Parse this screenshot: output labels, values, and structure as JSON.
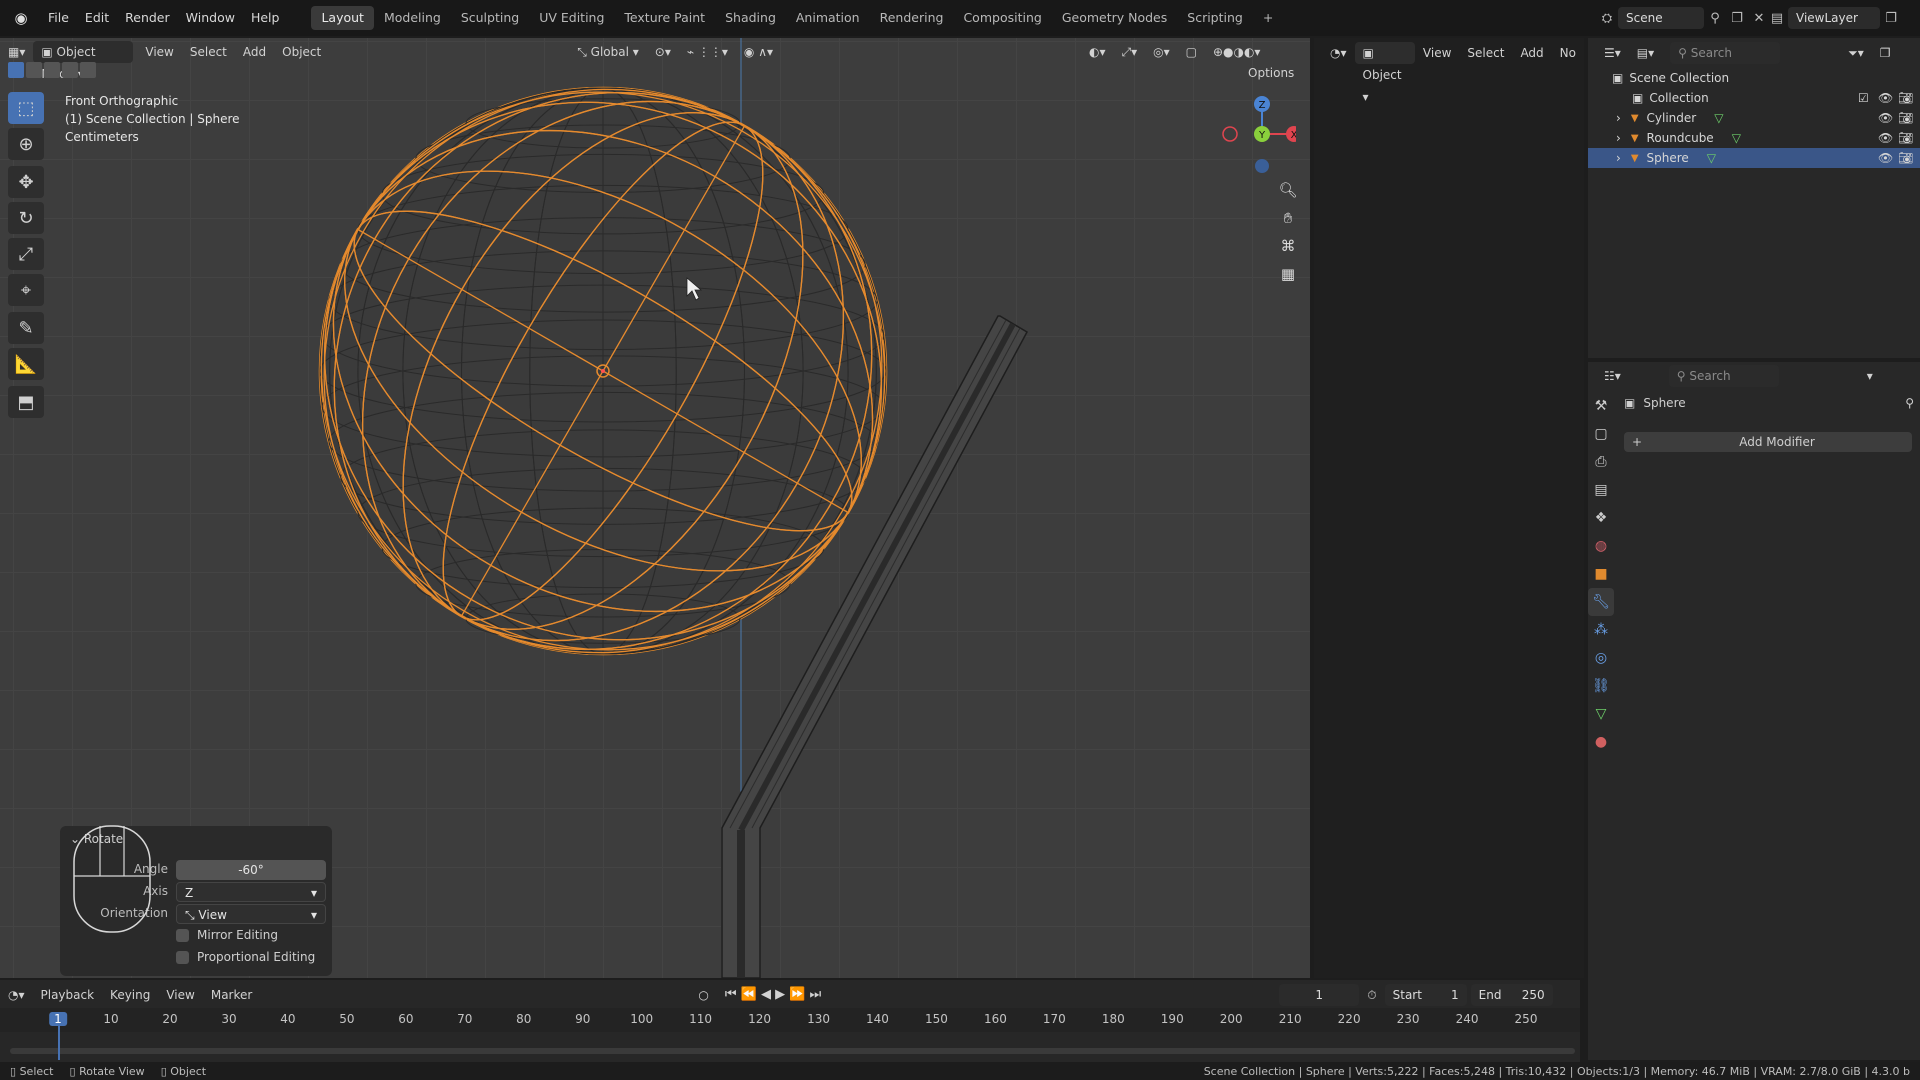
{
  "topbar": {
    "menus": [
      "File",
      "Edit",
      "Render",
      "Window",
      "Help"
    ],
    "workspaces": [
      {
        "label": "Layout",
        "active": true
      },
      {
        "label": "Modeling"
      },
      {
        "label": "Sculpting"
      },
      {
        "label": "UV Editing"
      },
      {
        "label": "Texture Paint"
      },
      {
        "label": "Shading"
      },
      {
        "label": "Animation"
      },
      {
        "label": "Rendering"
      },
      {
        "label": "Compositing"
      },
      {
        "label": "Geometry Nodes"
      },
      {
        "label": "Scripting"
      }
    ],
    "add_tab": "+",
    "scene": "Scene",
    "viewlayer": "ViewLayer"
  },
  "viewport": {
    "mode": "Object Mode",
    "menus": [
      "View",
      "Select",
      "Add",
      "Object"
    ],
    "orientation": "Global",
    "options": "Options",
    "info": {
      "line1": "Front Orthographic",
      "line2": "(1) Scene Collection | Sphere",
      "line3": "Centimeters"
    },
    "gizmo": {
      "z": "Z",
      "y": "Y",
      "x": "X"
    }
  },
  "operator_panel": {
    "title": "Rotate",
    "angle_label": "Angle",
    "angle_value": "-60°",
    "axis_label": "Axis",
    "axis_value": "Z",
    "orientation_label": "Orientation",
    "orientation_value": "View",
    "mirror_label": "Mirror Editing",
    "proportional_label": "Proportional Editing"
  },
  "mid_editor": {
    "mode": "Object",
    "menus": [
      "View",
      "Select",
      "Add",
      "No"
    ]
  },
  "outliner": {
    "search_placeholder": "Search",
    "root": "Scene Collection",
    "collection": "Collection",
    "items": [
      {
        "label": "Cylinder",
        "selected": false
      },
      {
        "label": "Roundcube",
        "selected": false
      },
      {
        "label": "Sphere",
        "selected": true
      }
    ]
  },
  "properties": {
    "search_placeholder": "Search",
    "object_name": "Sphere",
    "add_modifier": "Add Modifier"
  },
  "timeline": {
    "menus": [
      "Playback",
      "Keying",
      "View",
      "Marker"
    ],
    "current_frame": "1",
    "start_label": "Start",
    "start_value": "1",
    "end_label": "End",
    "end_value": "250",
    "ticks": [
      "1",
      "10",
      "20",
      "30",
      "40",
      "50",
      "60",
      "70",
      "80",
      "90",
      "100",
      "110",
      "120",
      "130",
      "140",
      "150",
      "160",
      "170",
      "180",
      "190",
      "200",
      "210",
      "220",
      "230",
      "240",
      "250"
    ]
  },
  "status": {
    "left": [
      {
        "icon": "mouse-left-icon",
        "label": "Select"
      },
      {
        "icon": "mouse-middle-icon",
        "label": "Rotate View"
      },
      {
        "icon": "mouse-right-icon",
        "label": "Object"
      }
    ],
    "right": "Scene Collection | Sphere | Verts:5,222 | Faces:5,248 | Tris:10,432 | Objects:1/3 | Memory: 46.7 MiB | VRAM: 2.7/8.0 GiB | 4.3.0 b"
  },
  "colors": {
    "accent": "#4772b3",
    "selection": "#f0902a",
    "header": "#181818",
    "viewport": "#3d3d3d"
  }
}
